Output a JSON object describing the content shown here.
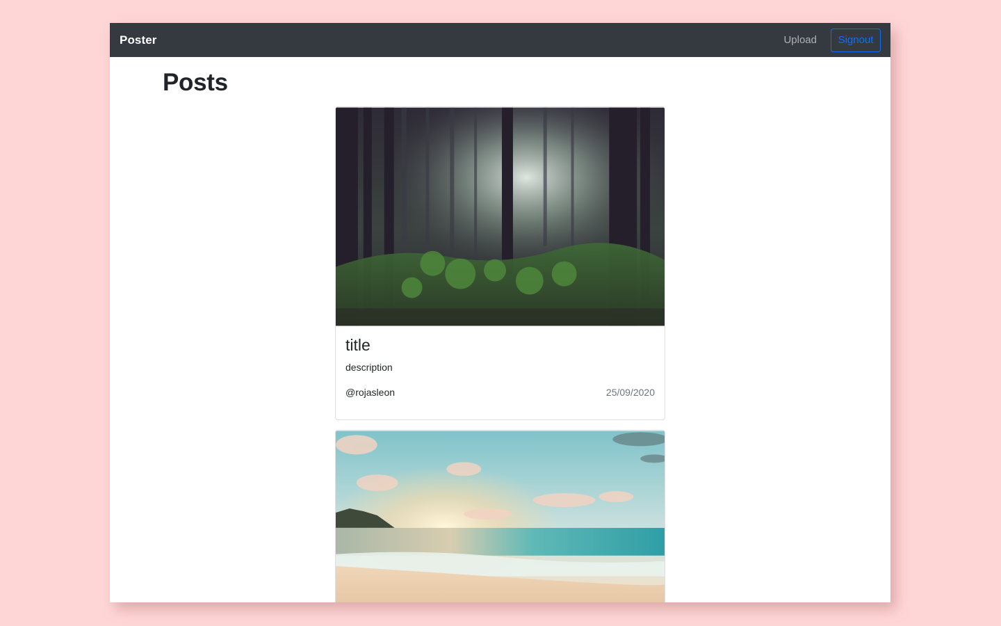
{
  "navbar": {
    "brand": "Poster",
    "upload_label": "Upload",
    "signout_label": "Signout"
  },
  "page": {
    "title": "Posts"
  },
  "posts": [
    {
      "image": "forest-photo",
      "title": "title",
      "description": "description",
      "user": "@rojasleon",
      "date": "25/09/2020"
    },
    {
      "image": "beach-sunset-photo"
    }
  ],
  "colors": {
    "background": "#ffd6d6",
    "navbar": "#343a40",
    "accent": "#0d6efd",
    "muted": "#6c757d"
  }
}
